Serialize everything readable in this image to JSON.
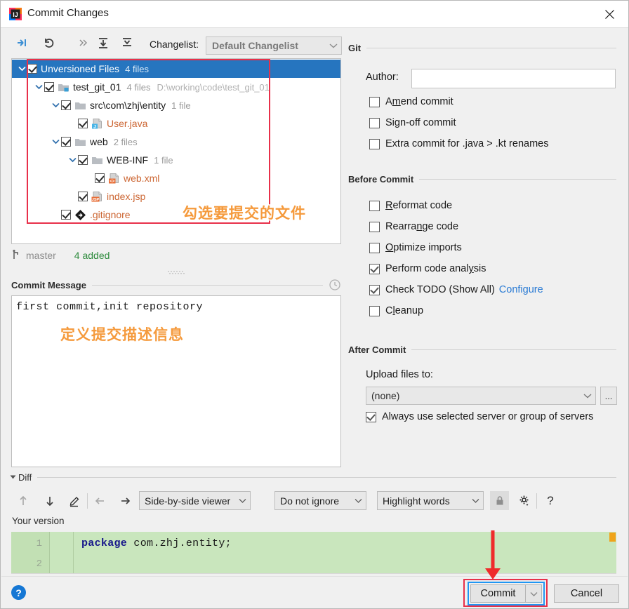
{
  "window": {
    "title": "Commit Changes",
    "app_icon": "intellij-idea-icon",
    "close_icon": "close-icon"
  },
  "toolbar": {
    "icons": [
      {
        "name": "collapse-to-left-icon",
        "glyph": "arrow-collapse"
      },
      {
        "name": "revert-icon",
        "glyph": "undo-arrow"
      },
      {
        "name": "more-actions-icon",
        "glyph": "»"
      },
      {
        "name": "expand-all-icon",
        "glyph": "expand"
      },
      {
        "name": "collapse-all-icon",
        "glyph": "collapse"
      }
    ],
    "changelist_label": "Changelist:",
    "changelist_value": "Default Changelist"
  },
  "tree": {
    "root": {
      "label": "Unversioned Files",
      "count": "4 files",
      "checked": true,
      "selected": true,
      "expanded": true
    },
    "nodes": [
      {
        "label": "test_git_01",
        "count": "4 files",
        "path": "D:\\working\\code\\test_git_01",
        "icon": "module-icon",
        "indent": 1,
        "checked": true,
        "expanded": true,
        "kind": "module"
      },
      {
        "label": "src\\com\\zhj\\entity",
        "count": "1 file",
        "path": "",
        "icon": "folder-icon",
        "indent": 2,
        "checked": true,
        "expanded": true,
        "kind": "folder"
      },
      {
        "label": "User.java",
        "count": "",
        "path": "",
        "icon": "java-file-icon",
        "indent": 3,
        "checked": true,
        "expanded": null,
        "kind": "file"
      },
      {
        "label": "web",
        "count": "2 files",
        "path": "",
        "icon": "folder-icon",
        "indent": 2,
        "checked": true,
        "expanded": true,
        "kind": "folder"
      },
      {
        "label": "WEB-INF",
        "count": "1 file",
        "path": "",
        "icon": "folder-icon",
        "indent": 3,
        "checked": true,
        "expanded": true,
        "kind": "folder"
      },
      {
        "label": "web.xml",
        "count": "",
        "path": "",
        "icon": "xml-file-icon",
        "indent": 4,
        "checked": true,
        "expanded": null,
        "kind": "file"
      },
      {
        "label": "index.jsp",
        "count": "",
        "path": "",
        "icon": "jsp-file-icon",
        "indent": 3,
        "checked": true,
        "expanded": null,
        "kind": "file"
      },
      {
        "label": ".gitignore",
        "count": "",
        "path": "",
        "icon": "gitignore-file-icon",
        "indent": 2,
        "checked": true,
        "expanded": null,
        "kind": "file"
      }
    ],
    "status": {
      "branch_icon": "git-branch-icon",
      "branch": "master",
      "added": "4 added"
    }
  },
  "commit_message": {
    "section_title": "Commit Message",
    "history_icon": "clock-icon",
    "value": "first commit,init repository"
  },
  "git_section": {
    "title": "Git",
    "author_label": "Author:",
    "author_value": "",
    "options": [
      {
        "label": "Amend commit",
        "checked": false,
        "mnemonic_index": 1
      },
      {
        "label": "Sign-off commit",
        "checked": false,
        "mnemonic_index": 2
      },
      {
        "label": "Extra commit for .java > .kt renames",
        "checked": false,
        "mnemonic_index": -1
      }
    ]
  },
  "before_commit": {
    "title": "Before Commit",
    "options": [
      {
        "label": "Reformat code",
        "checked": false,
        "mnemonic_index": 0
      },
      {
        "label": "Rearrange code",
        "checked": false,
        "mnemonic_index": 6
      },
      {
        "label": "Optimize imports",
        "checked": false,
        "mnemonic_index": 0
      },
      {
        "label": "Perform code analysis",
        "checked": true,
        "mnemonic_index": 17
      },
      {
        "label": "Check TODO (Show All)",
        "checked": true,
        "mnemonic_index": -1,
        "link": "Configure"
      },
      {
        "label": "Cleanup",
        "checked": false,
        "mnemonic_index": 1
      }
    ]
  },
  "after_commit": {
    "title": "After Commit",
    "upload_label": "Upload files to:",
    "upload_value": "(none)",
    "browse_label": "...",
    "always_use": {
      "label": "Always use selected server or group of servers",
      "checked": true
    }
  },
  "diff": {
    "section_title": "Diff",
    "nav_icons": [
      {
        "name": "previous-difference-icon",
        "glyph": "up-arrow"
      },
      {
        "name": "next-difference-icon",
        "glyph": "down-arrow"
      },
      {
        "name": "edit-source-icon",
        "glyph": "pencil"
      },
      {
        "name": "accept-left-icon",
        "glyph": "left-arrow"
      },
      {
        "name": "accept-right-icon",
        "glyph": "right-arrow"
      }
    ],
    "viewer_mode": "Side-by-side viewer",
    "whitespace_mode": "Do not ignore",
    "highlight_mode": "Highlight words",
    "lock_icon": "lock-icon",
    "settings_icon": "gear-icon",
    "help_icon": "question-mark-icon",
    "your_version_label": "Your version",
    "code_lines": [
      {
        "number": "1",
        "keyword": "package",
        "rest": " com.zhj.entity;"
      },
      {
        "number": "2",
        "keyword": "",
        "rest": ""
      }
    ]
  },
  "footer": {
    "help_label": "?",
    "commit_label": "Commit",
    "commit_dropdown_icon": "chevron-down-icon",
    "cancel_label": "Cancel"
  },
  "annotations": [
    {
      "name": "tree-highlight-box",
      "type": "rect"
    },
    {
      "name": "annotation-select-files",
      "type": "text",
      "text": "勾选要提交的文件"
    },
    {
      "name": "annotation-define-message",
      "type": "text",
      "text": "定义提交描述信息"
    },
    {
      "name": "commit-button-highlight",
      "type": "rect"
    },
    {
      "name": "commit-button-arrow",
      "type": "arrow"
    }
  ],
  "colors": {
    "selection_blue": "#2675bf",
    "unversioned_file": "#cc6633",
    "added_green": "#2e8b3d",
    "link_blue": "#2a7bd4",
    "annotation_red": "#e8304a",
    "annotation_orange": "#f59a3c",
    "diff_added_bg": "#c9e6bd",
    "focus_blue": "#2196f3"
  }
}
